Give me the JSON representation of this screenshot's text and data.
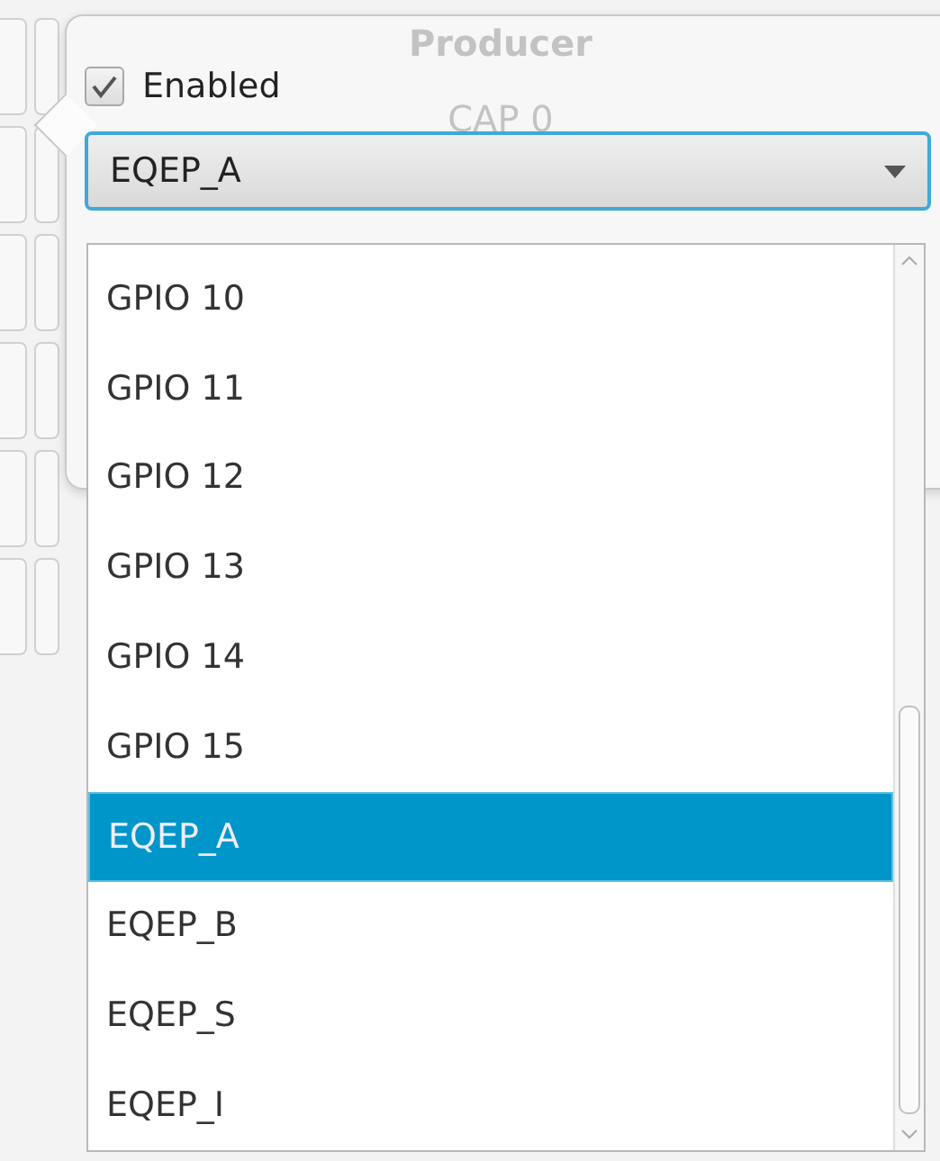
{
  "background": {
    "column_header": "Producer",
    "cell": "CAP 0"
  },
  "popup": {
    "checkbox": {
      "label": "Enabled",
      "checked": true
    },
    "combo": {
      "value": "EQEP_A"
    },
    "options": [
      {
        "label": "GPIO 10",
        "selected": false
      },
      {
        "label": "GPIO 11",
        "selected": false
      },
      {
        "label": "GPIO 12",
        "selected": false
      },
      {
        "label": "GPIO 13",
        "selected": false
      },
      {
        "label": "GPIO 14",
        "selected": false
      },
      {
        "label": "GPIO 15",
        "selected": false
      },
      {
        "label": "EQEP_A",
        "selected": true
      },
      {
        "label": "EQEP_B",
        "selected": false
      },
      {
        "label": "EQEP_S",
        "selected": false
      },
      {
        "label": "EQEP_I",
        "selected": false
      }
    ]
  }
}
